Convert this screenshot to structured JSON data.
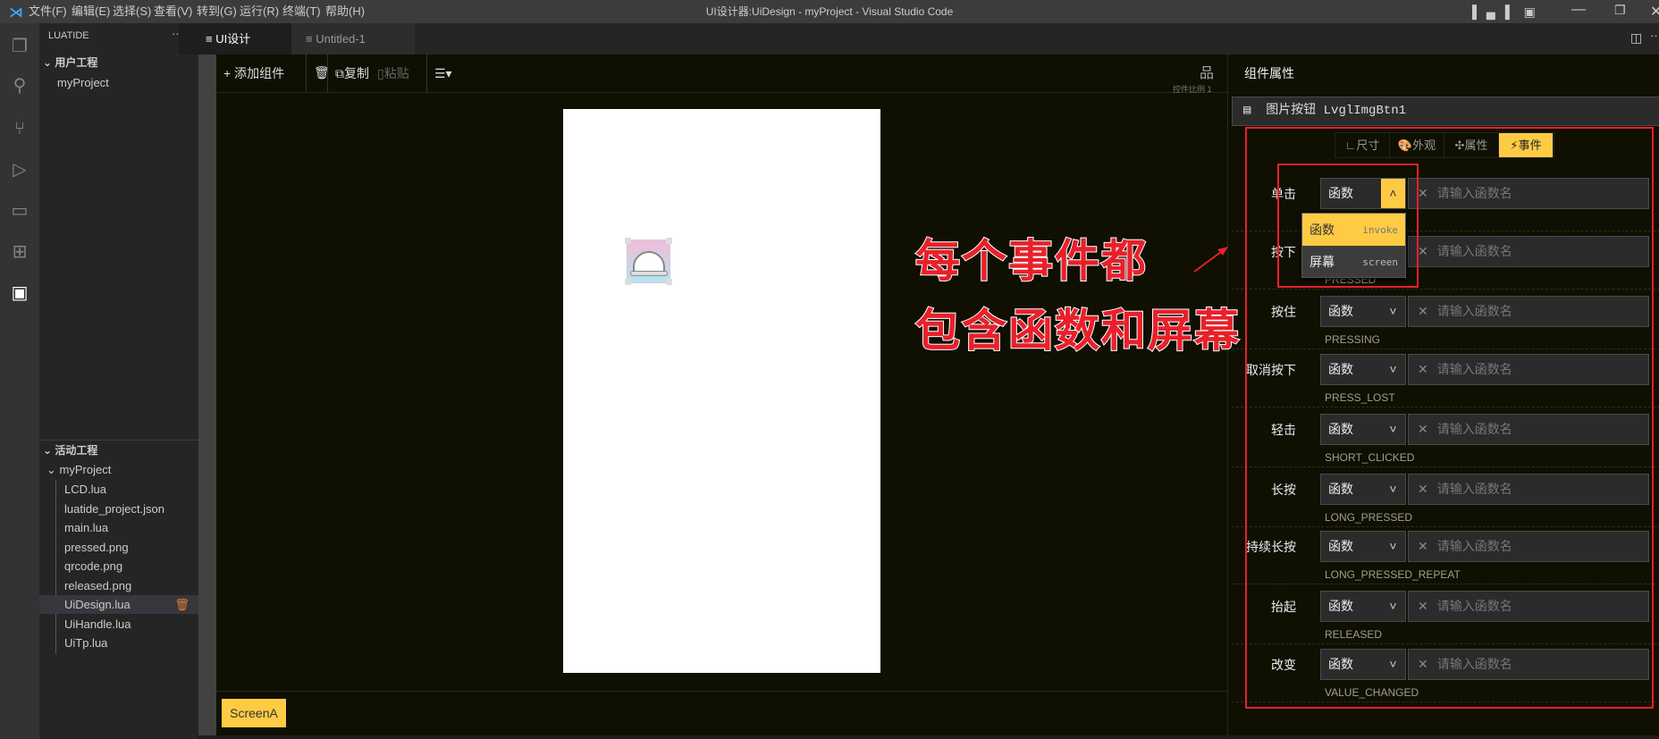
{
  "titlebar": {
    "menus": [
      "文件(F)",
      "编辑(E)",
      "选择(S)",
      "查看(V)",
      "转到(G)",
      "运行(R)",
      "终端(T)",
      "帮助(H)"
    ],
    "title": "UI设计器:UiDesign - myProject - Visual Studio Code"
  },
  "sidebar": {
    "header": "LUATIDE",
    "more": "···",
    "user_section": "用户工程",
    "user_projects": [
      "myProject"
    ],
    "active_section": "活动工程",
    "active_project": "myProject",
    "files": [
      "LCD.lua",
      "luatide_project.json",
      "main.lua",
      "pressed.png",
      "qrcode.png",
      "released.png",
      "UiDesign.lua",
      "UiHandle.lua",
      "UiTp.lua"
    ],
    "selected_file": "UiDesign.lua"
  },
  "tabs": [
    {
      "label": "UI设计器:UiDesign",
      "close": "✕"
    },
    {
      "label": "Untitled-1"
    }
  ],
  "toolbar": {
    "add": "+ 添加组件",
    "copy": "复制",
    "paste": "粘贴",
    "scale": "控件比例 1"
  },
  "screens": [
    "ScreenA"
  ],
  "panel": {
    "title": "组件属性",
    "component": "图片按钮 LvglImgBtn1",
    "tabs": [
      "尺寸",
      "外观",
      "属性",
      "事件"
    ],
    "active_tab": "事件",
    "events": [
      {
        "label": "单击",
        "code": "",
        "open": true
      },
      {
        "label": "按下",
        "code": "PRESSED"
      },
      {
        "label": "按住",
        "code": "PRESSING"
      },
      {
        "label": "取消按下",
        "code": "PRESS_LOST"
      },
      {
        "label": "轻击",
        "code": "SHORT_CLICKED"
      },
      {
        "label": "长按",
        "code": "LONG_PRESSED"
      },
      {
        "label": "持续长按",
        "code": "LONG_PRESSED_REPEAT"
      },
      {
        "label": "抬起",
        "code": "RELEASED"
      },
      {
        "label": "改变",
        "code": "VALUE_CHANGED"
      }
    ],
    "select_value": "函数",
    "placeholder": "请输入函数名",
    "dropdown": [
      {
        "label": "函数",
        "value": "invoke"
      },
      {
        "label": "屏幕",
        "value": "screen"
      }
    ]
  },
  "annotation": {
    "line1": "每个事件都",
    "line2": "包含函数和屏幕"
  },
  "colors": {
    "accent": "#ffcb45",
    "annotation": "#e8202a"
  }
}
